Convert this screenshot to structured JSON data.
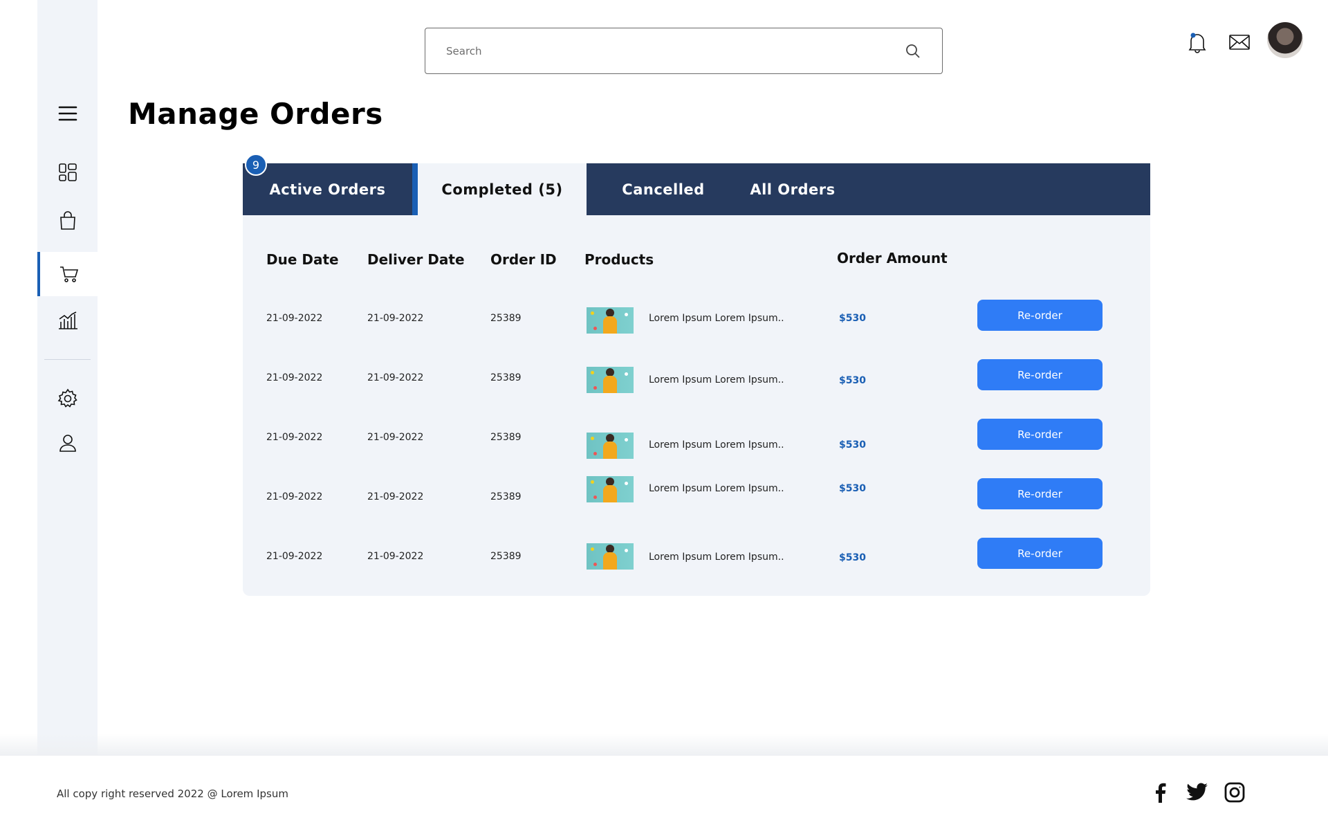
{
  "search": {
    "placeholder": "Search"
  },
  "page": {
    "title": "Manage Orders"
  },
  "tabs": [
    {
      "label": "Active Orders",
      "badge": "9"
    },
    {
      "label": "Completed (5)"
    },
    {
      "label": "Cancelled"
    },
    {
      "label": "All Orders"
    }
  ],
  "table": {
    "headers": [
      "Due Date",
      "Deliver Date",
      "Order ID",
      "Products",
      "Order Amount"
    ],
    "rows": [
      {
        "due_date": "21-09-2022",
        "deliver_date": "21-09-2022",
        "order_id": "25389",
        "product": "Lorem Ipsum Lorem Ipsum..",
        "amount": "$530",
        "action": "Re-order"
      },
      {
        "due_date": "21-09-2022",
        "deliver_date": "21-09-2022",
        "order_id": "25389",
        "product": "Lorem Ipsum Lorem Ipsum..",
        "amount": "$530",
        "action": "Re-order"
      },
      {
        "due_date": "21-09-2022",
        "deliver_date": "21-09-2022",
        "order_id": "25389",
        "product": "Lorem Ipsum Lorem Ipsum..",
        "amount": "$530",
        "action": "Re-order"
      },
      {
        "due_date": "21-09-2022",
        "deliver_date": "21-09-2022",
        "order_id": "25389",
        "product": "Lorem Ipsum Lorem Ipsum..",
        "amount": "$530",
        "action": "Re-order"
      },
      {
        "due_date": "21-09-2022",
        "deliver_date": "21-09-2022",
        "order_id": "25389",
        "product": "Lorem Ipsum Lorem Ipsum..",
        "amount": "$530",
        "action": "Re-order"
      }
    ]
  },
  "footer": {
    "copyright": "All copy right reserved 2022 @ Lorem Ipsum"
  },
  "icons": {
    "sidebar": [
      "menu-icon",
      "dashboard-icon",
      "shopping-bag-icon",
      "cart-icon",
      "analytics-icon",
      "settings-icon",
      "user-icon"
    ],
    "header": [
      "search-icon",
      "bell-icon",
      "mail-icon",
      "avatar"
    ],
    "social": [
      "facebook-icon",
      "twitter-icon",
      "instagram-icon"
    ]
  },
  "colors": {
    "accent": "#1a5fb4",
    "tab_bar": "#263a5e",
    "button": "#2f7cf6",
    "panel": "#f1f4f9"
  }
}
